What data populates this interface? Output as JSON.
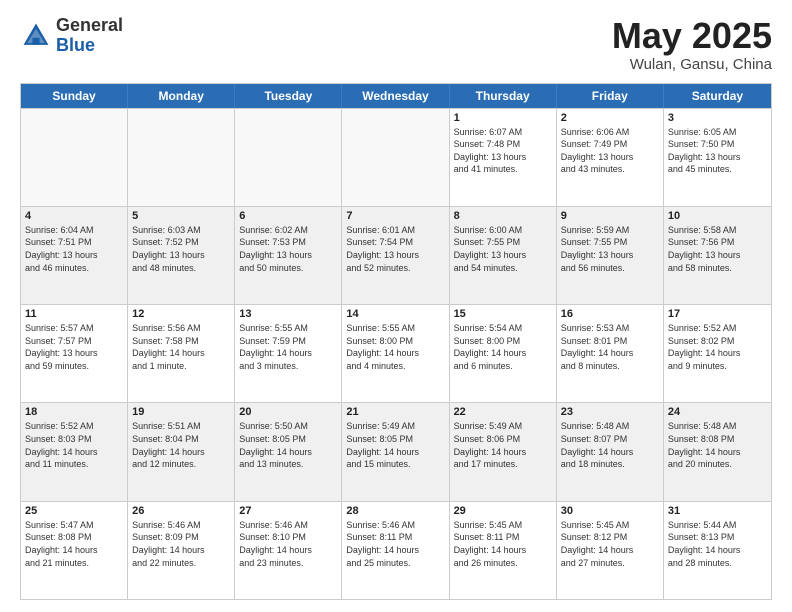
{
  "logo": {
    "general": "General",
    "blue": "Blue"
  },
  "header": {
    "month": "May 2025",
    "location": "Wulan, Gansu, China"
  },
  "weekdays": [
    "Sunday",
    "Monday",
    "Tuesday",
    "Wednesday",
    "Thursday",
    "Friday",
    "Saturday"
  ],
  "weeks": [
    [
      {
        "day": "",
        "info": ""
      },
      {
        "day": "",
        "info": ""
      },
      {
        "day": "",
        "info": ""
      },
      {
        "day": "",
        "info": ""
      },
      {
        "day": "1",
        "info": "Sunrise: 6:07 AM\nSunset: 7:48 PM\nDaylight: 13 hours\nand 41 minutes."
      },
      {
        "day": "2",
        "info": "Sunrise: 6:06 AM\nSunset: 7:49 PM\nDaylight: 13 hours\nand 43 minutes."
      },
      {
        "day": "3",
        "info": "Sunrise: 6:05 AM\nSunset: 7:50 PM\nDaylight: 13 hours\nand 45 minutes."
      }
    ],
    [
      {
        "day": "4",
        "info": "Sunrise: 6:04 AM\nSunset: 7:51 PM\nDaylight: 13 hours\nand 46 minutes."
      },
      {
        "day": "5",
        "info": "Sunrise: 6:03 AM\nSunset: 7:52 PM\nDaylight: 13 hours\nand 48 minutes."
      },
      {
        "day": "6",
        "info": "Sunrise: 6:02 AM\nSunset: 7:53 PM\nDaylight: 13 hours\nand 50 minutes."
      },
      {
        "day": "7",
        "info": "Sunrise: 6:01 AM\nSunset: 7:54 PM\nDaylight: 13 hours\nand 52 minutes."
      },
      {
        "day": "8",
        "info": "Sunrise: 6:00 AM\nSunset: 7:55 PM\nDaylight: 13 hours\nand 54 minutes."
      },
      {
        "day": "9",
        "info": "Sunrise: 5:59 AM\nSunset: 7:55 PM\nDaylight: 13 hours\nand 56 minutes."
      },
      {
        "day": "10",
        "info": "Sunrise: 5:58 AM\nSunset: 7:56 PM\nDaylight: 13 hours\nand 58 minutes."
      }
    ],
    [
      {
        "day": "11",
        "info": "Sunrise: 5:57 AM\nSunset: 7:57 PM\nDaylight: 13 hours\nand 59 minutes."
      },
      {
        "day": "12",
        "info": "Sunrise: 5:56 AM\nSunset: 7:58 PM\nDaylight: 14 hours\nand 1 minute."
      },
      {
        "day": "13",
        "info": "Sunrise: 5:55 AM\nSunset: 7:59 PM\nDaylight: 14 hours\nand 3 minutes."
      },
      {
        "day": "14",
        "info": "Sunrise: 5:55 AM\nSunset: 8:00 PM\nDaylight: 14 hours\nand 4 minutes."
      },
      {
        "day": "15",
        "info": "Sunrise: 5:54 AM\nSunset: 8:00 PM\nDaylight: 14 hours\nand 6 minutes."
      },
      {
        "day": "16",
        "info": "Sunrise: 5:53 AM\nSunset: 8:01 PM\nDaylight: 14 hours\nand 8 minutes."
      },
      {
        "day": "17",
        "info": "Sunrise: 5:52 AM\nSunset: 8:02 PM\nDaylight: 14 hours\nand 9 minutes."
      }
    ],
    [
      {
        "day": "18",
        "info": "Sunrise: 5:52 AM\nSunset: 8:03 PM\nDaylight: 14 hours\nand 11 minutes."
      },
      {
        "day": "19",
        "info": "Sunrise: 5:51 AM\nSunset: 8:04 PM\nDaylight: 14 hours\nand 12 minutes."
      },
      {
        "day": "20",
        "info": "Sunrise: 5:50 AM\nSunset: 8:05 PM\nDaylight: 14 hours\nand 13 minutes."
      },
      {
        "day": "21",
        "info": "Sunrise: 5:49 AM\nSunset: 8:05 PM\nDaylight: 14 hours\nand 15 minutes."
      },
      {
        "day": "22",
        "info": "Sunrise: 5:49 AM\nSunset: 8:06 PM\nDaylight: 14 hours\nand 17 minutes."
      },
      {
        "day": "23",
        "info": "Sunrise: 5:48 AM\nSunset: 8:07 PM\nDaylight: 14 hours\nand 18 minutes."
      },
      {
        "day": "24",
        "info": "Sunrise: 5:48 AM\nSunset: 8:08 PM\nDaylight: 14 hours\nand 20 minutes."
      }
    ],
    [
      {
        "day": "25",
        "info": "Sunrise: 5:47 AM\nSunset: 8:08 PM\nDaylight: 14 hours\nand 21 minutes."
      },
      {
        "day": "26",
        "info": "Sunrise: 5:46 AM\nSunset: 8:09 PM\nDaylight: 14 hours\nand 22 minutes."
      },
      {
        "day": "27",
        "info": "Sunrise: 5:46 AM\nSunset: 8:10 PM\nDaylight: 14 hours\nand 23 minutes."
      },
      {
        "day": "28",
        "info": "Sunrise: 5:46 AM\nSunset: 8:11 PM\nDaylight: 14 hours\nand 25 minutes."
      },
      {
        "day": "29",
        "info": "Sunrise: 5:45 AM\nSunset: 8:11 PM\nDaylight: 14 hours\nand 26 minutes."
      },
      {
        "day": "30",
        "info": "Sunrise: 5:45 AM\nSunset: 8:12 PM\nDaylight: 14 hours\nand 27 minutes."
      },
      {
        "day": "31",
        "info": "Sunrise: 5:44 AM\nSunset: 8:13 PM\nDaylight: 14 hours\nand 28 minutes."
      }
    ]
  ]
}
